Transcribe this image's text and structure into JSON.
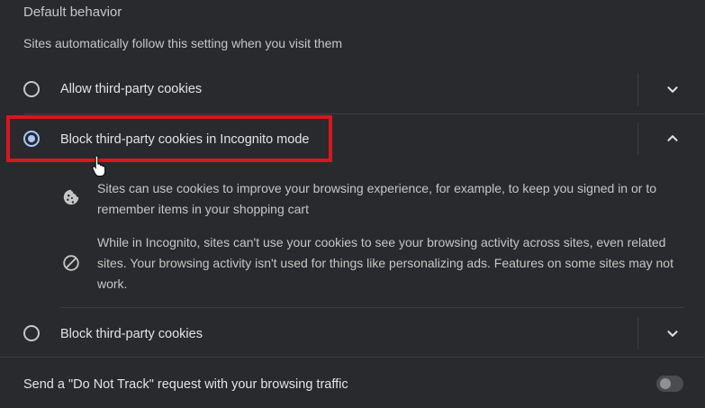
{
  "section": {
    "heading": "Default behavior",
    "subheading": "Sites automatically follow this setting when you visit them"
  },
  "options": [
    {
      "label": "Allow third-party cookies",
      "selected": false,
      "expanded": false,
      "chevron_icon": "chevron-down-icon"
    },
    {
      "label": "Block third-party cookies in Incognito mode",
      "selected": true,
      "expanded": true,
      "chevron_icon": "chevron-up-icon"
    },
    {
      "label": "Block third-party cookies",
      "selected": false,
      "expanded": false,
      "chevron_icon": "chevron-down-icon"
    }
  ],
  "expanded_details": [
    {
      "icon": "cookie-icon",
      "text": "Sites can use cookies to improve your browsing experience, for example, to keep you signed in or to remember items in your shopping cart"
    },
    {
      "icon": "block-icon",
      "text": "While in Incognito, sites can't use your cookies to see your browsing activity across sites, even related sites. Your browsing activity isn't used for things like personalizing ads. Features on some sites may not work."
    }
  ],
  "do_not_track": {
    "label": "Send a \"Do Not Track\" request with your browsing traffic",
    "enabled": false
  },
  "colors": {
    "background": "#292a2d",
    "accent": "#a8c7fa",
    "highlight_box": "#d8161f"
  }
}
